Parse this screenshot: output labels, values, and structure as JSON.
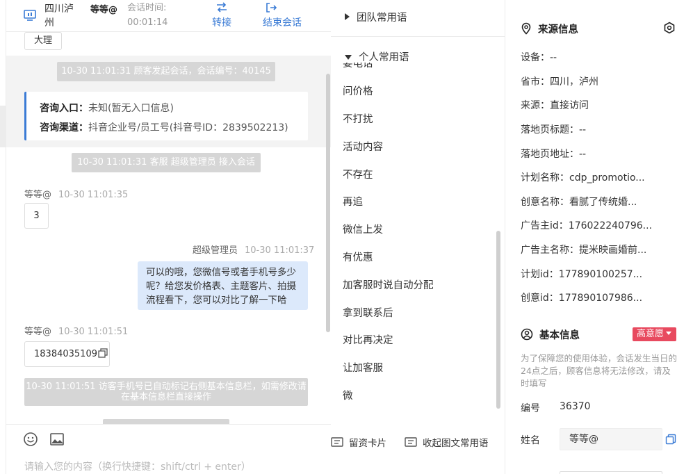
{
  "chat": {
    "header": {
      "region": "四川泸州",
      "visitor": "等等@",
      "timer_label": "会话时间:",
      "timer": "00:01:14",
      "transfer_label": "转接",
      "end_label": "结束会话"
    },
    "tag": "大理",
    "sys_start": "10-30 11:01:31 顾客发起会话，会话编号：40145",
    "entry": {
      "entry_label": "咨询入口：",
      "entry_value": "未知(暂无入口信息)",
      "channel_label": "咨询渠道：",
      "channel_value": "抖音企业号/员工号(抖音号ID：2839502213)"
    },
    "sys_join": "10-30 11:01:31 客服 超级管理员 接入会话",
    "messages": [
      {
        "sender": "等等@",
        "time": "10-30 11:01:35",
        "text": "3"
      },
      {
        "sender": "超级管理员",
        "time": "10-30 11:01:37",
        "text": "可以的哦，您微信号或者手机号多少呢？给您发价格表、主题客片、拍摄流程看下，您可以对比了解一下哈"
      },
      {
        "sender": "等等@",
        "time": "10-30 11:01:51",
        "text": "18384035109"
      }
    ],
    "sys_phone": "10-30 11:01:51 访客手机号已自动标记右侧基本信息栏，如需修改请在基本信息栏直接操作",
    "input_placeholder": "请输入您的内容（换行快捷键：shift/ctrl + enter）"
  },
  "phrases": {
    "team_group": "团队常用语",
    "personal_group": "个人常用语",
    "cut_item": "要电话",
    "items": [
      "问价格",
      "不打扰",
      "活动内容",
      "不存在",
      "再追",
      "微信上发",
      "有优惠",
      "加客服时说自动分配",
      "拿到联系后",
      "对比再决定",
      "让加客服",
      "微"
    ],
    "card_button": "留资卡片",
    "collapse_button": "收起图文常用语"
  },
  "info": {
    "source_title": "来源信息",
    "source": [
      {
        "label": "设备：",
        "value": "--"
      },
      {
        "label": "省市：",
        "value": "四川，泸州"
      },
      {
        "label": "来源：",
        "value": "直接访问"
      },
      {
        "label": "落地页标题：",
        "value": "--"
      },
      {
        "label": "落地页地址：",
        "value": "--"
      },
      {
        "label": "计划名称：",
        "value": "cdp_promotio..."
      },
      {
        "label": "创意名称：",
        "value": "看腻了传统婚..."
      },
      {
        "label": "广告主id：",
        "value": "176022240796..."
      },
      {
        "label": "广告主名称：",
        "value": "提米映画婚前..."
      },
      {
        "label": "计划id：",
        "value": "177890100257..."
      },
      {
        "label": "创意id：",
        "value": "177890107986..."
      }
    ],
    "basic_title": "基本信息",
    "intent_badge": "高意愿",
    "notice": "为了保障您的使用体验，会话发生当日的24点之后，顾客信息将无法修改，请及时填写",
    "id_label": "编号",
    "id_value": "36370",
    "name_label": "姓名",
    "name_value": "等等@"
  },
  "colors": {
    "accent": "#3a7bd5",
    "badge": "#e84a5f",
    "agent_bubble": "#dce9fb",
    "system": "#d6d6d6"
  }
}
